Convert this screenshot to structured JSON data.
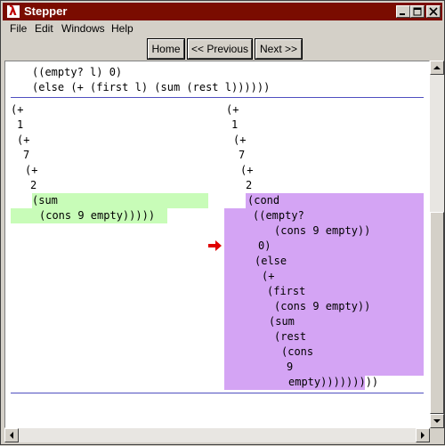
{
  "window": {
    "title": "Stepper",
    "app_icon": "lambda-icon"
  },
  "menu": [
    "File",
    "Edit",
    "Windows",
    "Help"
  ],
  "nav": {
    "home": "Home",
    "previous": "<< Previous",
    "next": "Next >>"
  },
  "context": {
    "line1": "((empty? l) 0)",
    "line2": "(else (+ (first l) (sum (rest l))))))"
  },
  "left_expr": [
    "(+",
    "1",
    "(+",
    "7",
    "(+",
    "2",
    "(sum",
    "(cons 9 empty)))))"
  ],
  "right_expr": [
    "(+",
    "1",
    "(+",
    "7",
    "(+",
    "2",
    "(cond",
    "((empty?",
    "(cons 9 empty))",
    "0)",
    "(else",
    "(+",
    "(first",
    "(cons 9 empty))",
    "(sum",
    "(rest",
    "(cons",
    "9",
    "empty)))))))))"
  ],
  "highlight_colors": {
    "reduced": "#c8fcb8",
    "redex": "#d4a4f4",
    "arrow": "#e00000"
  }
}
